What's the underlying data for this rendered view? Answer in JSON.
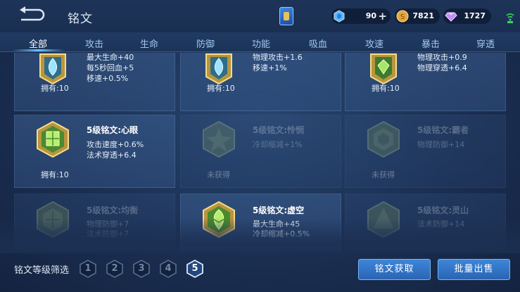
{
  "header": {
    "title": "铭文",
    "currencies": [
      {
        "icon": "blue-gem-icon",
        "value": "90"
      },
      {
        "icon": "gold-coin-icon",
        "value": "7821"
      },
      {
        "icon": "purple-diamond-icon",
        "value": "1727"
      }
    ]
  },
  "tabs": [
    "全部",
    "攻击",
    "生命",
    "防御",
    "功能",
    "吸血",
    "攻速",
    "暴击",
    "穿透"
  ],
  "active_tab": "全部",
  "cards": [
    {
      "id": "r1c1",
      "name": "",
      "stats": [
        "最大生命+40",
        "每5秒回血+5",
        "移速+0.5%"
      ],
      "owned": "拥有:10",
      "acquired": true,
      "gem": "blue-teardrop"
    },
    {
      "id": "r1c2",
      "name": "",
      "stats": [
        "物理攻击+1.6",
        "移速+1%"
      ],
      "owned": "拥有:10",
      "acquired": true,
      "gem": "blue-teardrop"
    },
    {
      "id": "r1c3",
      "name": "",
      "stats": [
        "物理攻击+0.9",
        "物理穿透+6.4"
      ],
      "owned": "拥有:10",
      "acquired": true,
      "gem": "green-leaf"
    },
    {
      "id": "r2c1",
      "name": "5级铭文:心眼",
      "stats": [
        "攻击速度+0.6%",
        "法术穿透+6.4"
      ],
      "owned": "拥有:10",
      "acquired": true,
      "gem": "green-square"
    },
    {
      "id": "r2c2",
      "name": "5级铭文:怜悯",
      "stats": [
        "冷却缩减+1%"
      ],
      "owned": "未获得",
      "acquired": false,
      "gem": "green-star"
    },
    {
      "id": "r2c3",
      "name": "5级铭文:霸者",
      "stats": [
        "物理防御+14"
      ],
      "owned": "未获得",
      "acquired": false,
      "gem": "green-hex"
    },
    {
      "id": "r3c1",
      "name": "5级铭文:均衡",
      "stats": [
        "物理防御+7",
        "法术防御+7"
      ],
      "owned": "",
      "acquired": false,
      "gem": "green-hex"
    },
    {
      "id": "r3c2",
      "name": "5级铭文:虚空",
      "stats": [
        "最大生命+45",
        "冷却缩减+0.5%"
      ],
      "owned": "",
      "acquired": true,
      "gem": "green-crest"
    },
    {
      "id": "r3c3",
      "name": "5级铭文:灵山",
      "stats": [
        "法术防御+14"
      ],
      "owned": "",
      "acquired": false,
      "gem": "green-hex"
    }
  ],
  "footer": {
    "filter_label": "铭文等级筛选",
    "levels": [
      "1",
      "2",
      "3",
      "4",
      "5"
    ],
    "selected_level": "5",
    "obtain_button": "铭文获取",
    "bulk_sell_button": "批量出售"
  },
  "colors": {
    "accent": "#3d86d8",
    "gold": "#e8c25a",
    "tab_inactive": "#9fc6ef"
  }
}
